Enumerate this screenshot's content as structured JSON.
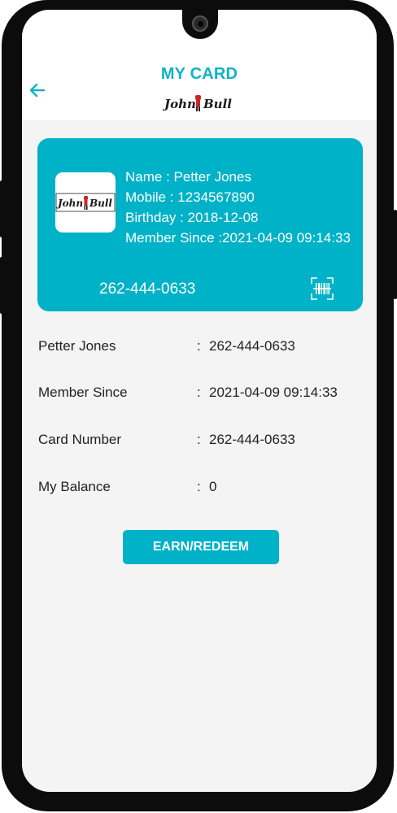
{
  "header": {
    "title": "MY CARD",
    "back_icon": "arrow-left-icon",
    "logo_text": "John Bull"
  },
  "card": {
    "logo_text": "John Bull",
    "name_line": "Name : Petter Jones",
    "mobile_line": "Mobile : 1234567890",
    "birthday_line": "Birthday : 2018-12-08",
    "member_since_line": "Member Since :2021-04-09 09:14:33",
    "card_number": "262-444-0633",
    "barcode_icon": "barcode-scan-icon"
  },
  "details": [
    {
      "label": "Petter Jones",
      "value": "262-444-0633"
    },
    {
      "label": "Member Since",
      "value": "2021-04-09 09:14:33"
    },
    {
      "label": "Card Number",
      "value": "262-444-0633"
    },
    {
      "label": "My Balance",
      "value": "0"
    }
  ],
  "separator": ":",
  "earn_button_label": "EARN/REDEEM",
  "colors": {
    "accent": "#00b2c7",
    "title": "#12b2c6",
    "background": "#f4f4f4"
  }
}
